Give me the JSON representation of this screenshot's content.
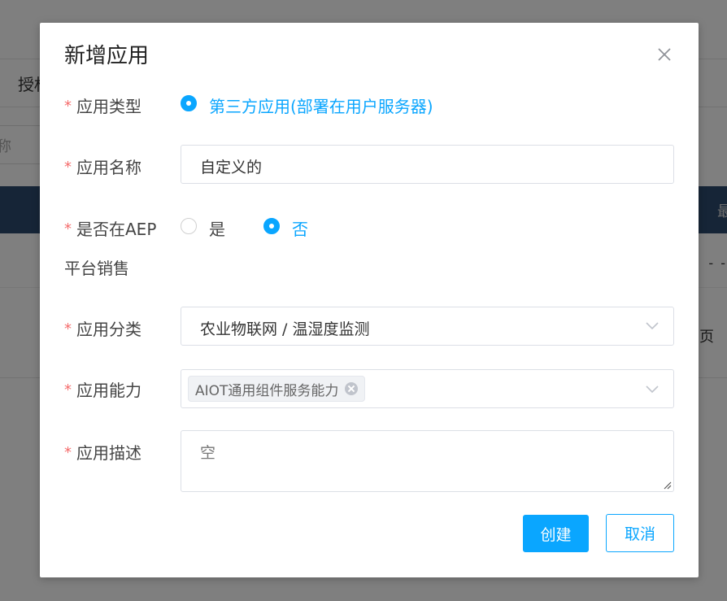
{
  "background": {
    "tab_label": "授权",
    "search_placeholder_fragment": "称",
    "table_header_fragment": "最",
    "cell_fragment": "- -",
    "pager_fragment": "页"
  },
  "dialog": {
    "title": "新增应用",
    "close_icon": "close-icon",
    "fields": {
      "app_type": {
        "label": "应用类型",
        "options": [
          {
            "label": "第三方应用(部署在用户服务器)",
            "selected": true
          }
        ]
      },
      "app_name": {
        "label": "应用名称",
        "value": "自定义的"
      },
      "aep_sale": {
        "label_line1": "是否在AEP",
        "label_line2": "平台销售",
        "options": [
          {
            "label": "是",
            "selected": false
          },
          {
            "label": "否",
            "selected": true
          }
        ]
      },
      "app_category": {
        "label": "应用分类",
        "value": "农业物联网 / 温湿度监测"
      },
      "app_capability": {
        "label": "应用能力",
        "tags": [
          "AIOT通用组件服务能力"
        ]
      },
      "app_description": {
        "label": "应用描述",
        "placeholder": "空"
      }
    },
    "required_mark": "*",
    "buttons": {
      "create": "创建",
      "cancel": "取消"
    }
  },
  "colors": {
    "accent": "#0aa6ff",
    "required": "#f56c6c",
    "overlay": "rgba(0,0,0,0.5)"
  }
}
